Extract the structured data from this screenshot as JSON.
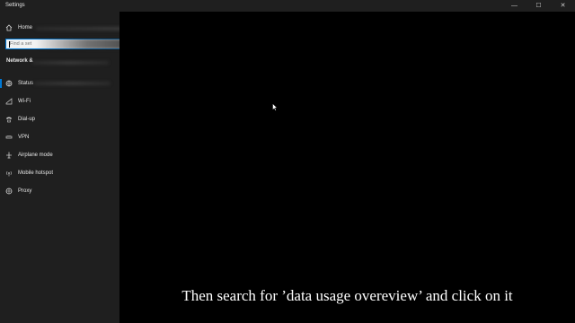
{
  "window": {
    "title": "Settings",
    "controls": {
      "minimize_glyph": "—",
      "maximize_glyph": "☐",
      "close_glyph": "✕"
    }
  },
  "sidebar": {
    "home_label": "Home",
    "search": {
      "value": "",
      "placeholder": "Find a set"
    },
    "section_title": "Network &",
    "items": [
      {
        "label": "Status",
        "icon": "globe-icon",
        "selected": true
      },
      {
        "label": "Wi-Fi",
        "icon": "wifi-icon",
        "selected": false
      },
      {
        "label": "Dial-up",
        "icon": "phone-icon",
        "selected": false
      },
      {
        "label": "VPN",
        "icon": "vpn-icon",
        "selected": false
      },
      {
        "label": "Airplane mode",
        "icon": "airplane-icon",
        "selected": false
      },
      {
        "label": "Mobile hotspot",
        "icon": "hotspot-icon",
        "selected": false
      },
      {
        "label": "Proxy",
        "icon": "proxy-globe-icon",
        "selected": false
      }
    ]
  },
  "caption": {
    "text": "Then search for ’data usage overeview’ and click on it"
  },
  "colors": {
    "accent": "#0078d4",
    "sidebar_bg": "#1f1f1f",
    "content_bg": "#000000",
    "text": "#e6e6e6"
  }
}
